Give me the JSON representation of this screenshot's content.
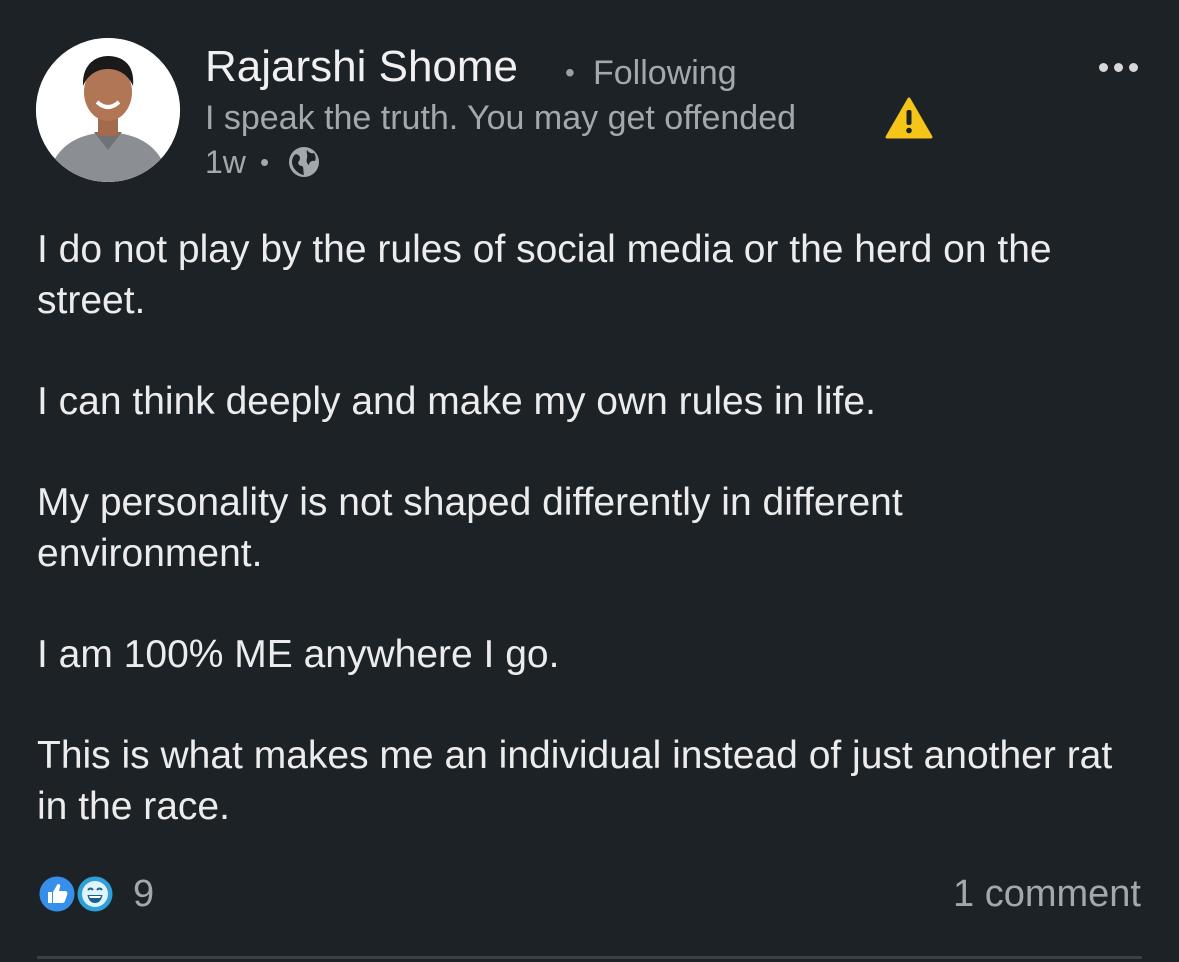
{
  "author": {
    "name": "Rajarshi Shome",
    "separator": "•",
    "follow_status": "Following",
    "headline": "I speak the truth. You may get offended",
    "headline_icon": "warning-icon",
    "timestamp": "1w",
    "timestamp_separator": "•",
    "visibility_icon": "globe-icon"
  },
  "menu": {
    "icon": "more-options-icon"
  },
  "post": {
    "paragraphs": [
      "I do not play by the rules of social media or the herd on the street.",
      "I can think deeply and make my own rules in life.",
      "My personality is not shaped differently in different environment.",
      "I am 100% ME anywhere I go.",
      "This is what makes me an individual instead of just another rat in the race."
    ]
  },
  "social": {
    "reaction_icons": [
      "like-icon",
      "funny-icon"
    ],
    "reaction_count": "9",
    "comments_label": "1 comment"
  },
  "colors": {
    "background": "#1d2226",
    "primary_text": "#ececec",
    "secondary_text": "#a3a8ad",
    "like_blue": "#378fe9",
    "warning_yellow": "#f5c518"
  }
}
